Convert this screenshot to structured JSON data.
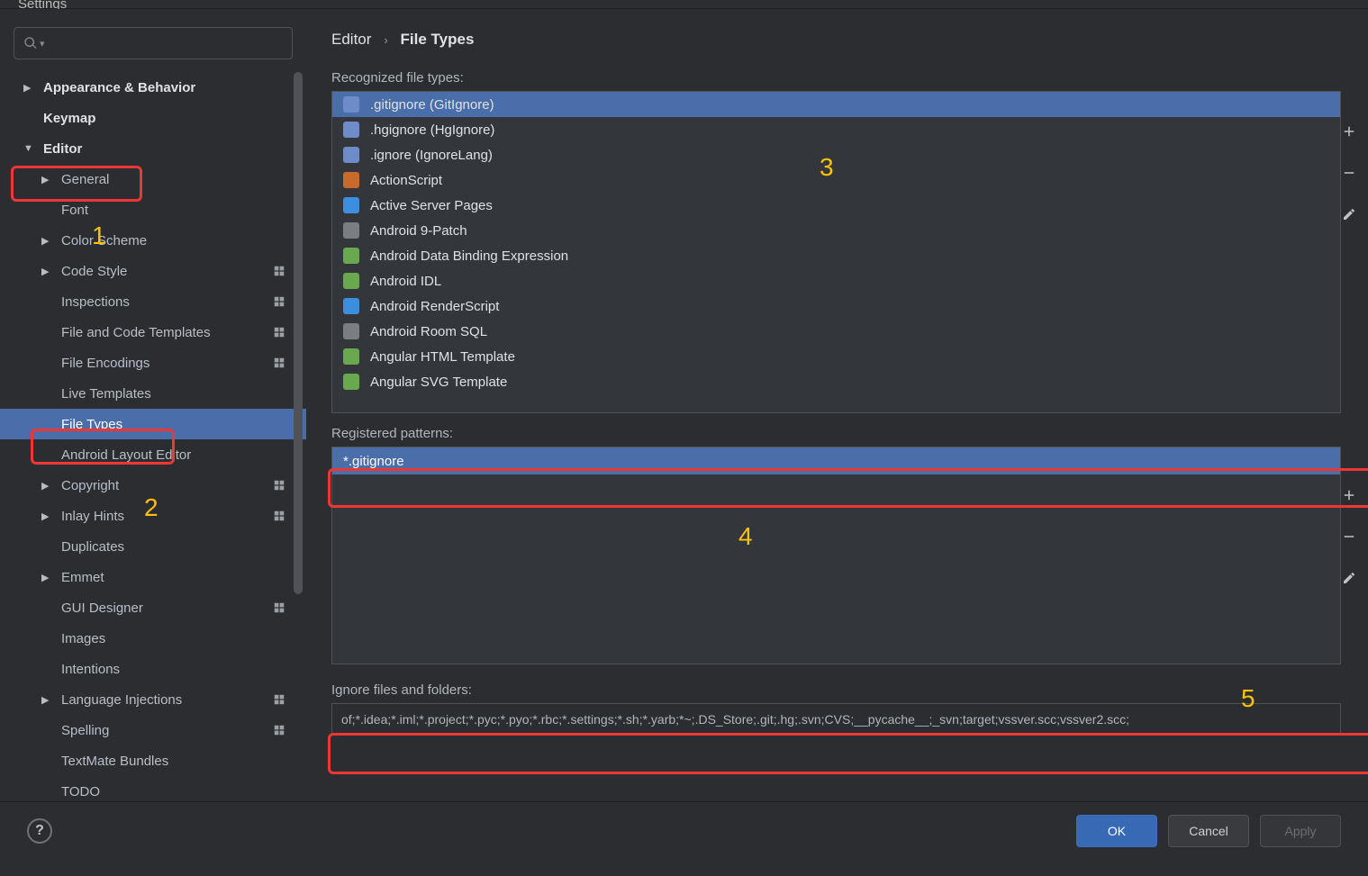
{
  "title": "Settings",
  "sidebar": {
    "items": [
      {
        "label": "Appearance & Behavior",
        "chev": "▶",
        "bold": true,
        "indent": 0,
        "scheme": false
      },
      {
        "label": "Keymap",
        "chev": "",
        "bold": true,
        "indent": 0,
        "scheme": false
      },
      {
        "label": "Editor",
        "chev": "▼",
        "bold": true,
        "indent": 0,
        "scheme": false
      },
      {
        "label": "General",
        "chev": "▶",
        "bold": false,
        "indent": 1,
        "scheme": false
      },
      {
        "label": "Font",
        "chev": "",
        "bold": false,
        "indent": 1,
        "scheme": false
      },
      {
        "label": "Color Scheme",
        "chev": "▶",
        "bold": false,
        "indent": 1,
        "scheme": false
      },
      {
        "label": "Code Style",
        "chev": "▶",
        "bold": false,
        "indent": 1,
        "scheme": true
      },
      {
        "label": "Inspections",
        "chev": "",
        "bold": false,
        "indent": 1,
        "scheme": true
      },
      {
        "label": "File and Code Templates",
        "chev": "",
        "bold": false,
        "indent": 1,
        "scheme": true
      },
      {
        "label": "File Encodings",
        "chev": "",
        "bold": false,
        "indent": 1,
        "scheme": true
      },
      {
        "label": "Live Templates",
        "chev": "",
        "bold": false,
        "indent": 1,
        "scheme": false
      },
      {
        "label": "File Types",
        "chev": "",
        "bold": false,
        "indent": 1,
        "scheme": false,
        "selected": true
      },
      {
        "label": "Android Layout Editor",
        "chev": "",
        "bold": false,
        "indent": 1,
        "scheme": false
      },
      {
        "label": "Copyright",
        "chev": "▶",
        "bold": false,
        "indent": 1,
        "scheme": true
      },
      {
        "label": "Inlay Hints",
        "chev": "▶",
        "bold": false,
        "indent": 1,
        "scheme": true
      },
      {
        "label": "Duplicates",
        "chev": "",
        "bold": false,
        "indent": 1,
        "scheme": false
      },
      {
        "label": "Emmet",
        "chev": "▶",
        "bold": false,
        "indent": 1,
        "scheme": false
      },
      {
        "label": "GUI Designer",
        "chev": "",
        "bold": false,
        "indent": 1,
        "scheme": true
      },
      {
        "label": "Images",
        "chev": "",
        "bold": false,
        "indent": 1,
        "scheme": false
      },
      {
        "label": "Intentions",
        "chev": "",
        "bold": false,
        "indent": 1,
        "scheme": false
      },
      {
        "label": "Language Injections",
        "chev": "▶",
        "bold": false,
        "indent": 1,
        "scheme": true
      },
      {
        "label": "Spelling",
        "chev": "",
        "bold": false,
        "indent": 1,
        "scheme": true
      },
      {
        "label": "TextMate Bundles",
        "chev": "",
        "bold": false,
        "indent": 1,
        "scheme": false
      },
      {
        "label": "TODO",
        "chev": "",
        "bold": false,
        "indent": 1,
        "scheme": false
      }
    ]
  },
  "breadcrumb": {
    "a": "Editor",
    "sep": "›",
    "b": "File Types"
  },
  "recognized": {
    "label": "Recognized file types:",
    "rows": [
      {
        "label": ".gitignore (GitIgnore)",
        "icon": "git",
        "selected": true
      },
      {
        "label": ".hgignore (HgIgnore)",
        "icon": "hg"
      },
      {
        "label": ".ignore (IgnoreLang)",
        "icon": "ig"
      },
      {
        "label": "ActionScript",
        "icon": "as"
      },
      {
        "label": "Active Server Pages",
        "icon": "asp"
      },
      {
        "label": "Android 9-Patch",
        "icon": "9p"
      },
      {
        "label": "Android Data Binding Expression",
        "icon": "db"
      },
      {
        "label": "Android IDL",
        "icon": "idl"
      },
      {
        "label": "Android RenderScript",
        "icon": "rs"
      },
      {
        "label": "Android Room SQL",
        "icon": "sql"
      },
      {
        "label": "Angular HTML Template",
        "icon": "ang"
      },
      {
        "label": "Angular SVG Template",
        "icon": "ang"
      }
    ]
  },
  "patterns": {
    "label": "Registered patterns:",
    "rows": [
      {
        "label": "*.gitignore",
        "selected": true
      }
    ]
  },
  "ignore": {
    "label": "Ignore files and folders:",
    "value": "of;*.idea;*.iml;*.project;*.pyc;*.pyo;*.rbc;*.settings;*.sh;*.yarb;*~;.DS_Store;.git;.hg;.svn;CVS;__pycache__;_svn;target;vssver.scc;vssver2.scc;"
  },
  "annotations": {
    "a1": "1",
    "a2": "2",
    "a3": "3",
    "a4": "4",
    "a5": "5"
  },
  "footer": {
    "ok": "OK",
    "cancel": "Cancel",
    "apply": "Apply",
    "help": "?"
  }
}
